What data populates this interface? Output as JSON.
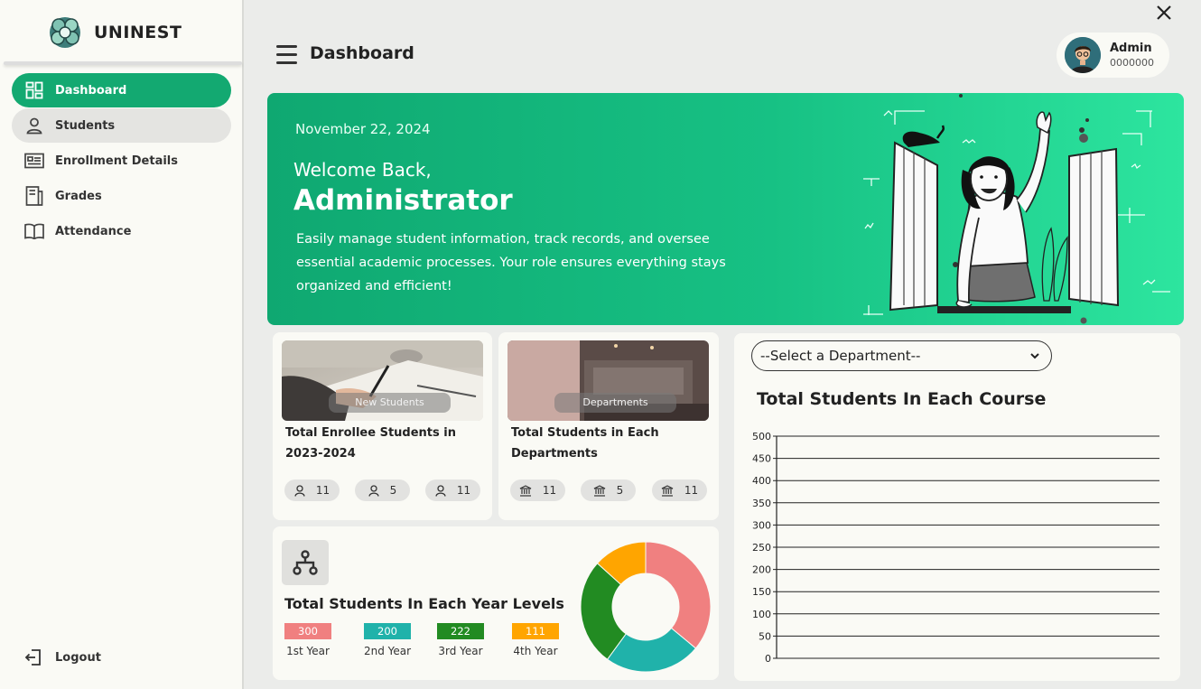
{
  "app": {
    "brand": "UNINEST"
  },
  "sidebar": {
    "items": [
      {
        "label": "Dashboard",
        "icon": "dashboard-grid-icon",
        "active": true
      },
      {
        "label": "Students",
        "icon": "user-icon",
        "hover": true
      },
      {
        "label": "Enrollment Details",
        "icon": "id-card-icon"
      },
      {
        "label": "Grades",
        "icon": "document-icon"
      },
      {
        "label": "Attendance",
        "icon": "book-icon"
      }
    ],
    "logout_label": "Logout"
  },
  "header": {
    "title": "Dashboard",
    "user": {
      "name": "Admin",
      "id": "0000000"
    }
  },
  "banner": {
    "date": "November 22, 2024",
    "welcome": "Welcome Back,",
    "name": "Administrator",
    "description": "Easily manage student information, track records, and oversee essential academic processes. Your role ensures everything stays organized and efficient!"
  },
  "cards": {
    "enrollees": {
      "image_caption": "New Students",
      "title": "Total Enrollee Students in 2023-2024",
      "pills": [
        "11",
        "5",
        "11"
      ]
    },
    "departments": {
      "image_caption": "Departments",
      "title": "Total Students in Each Departments",
      "pills": [
        "11",
        "5",
        "11"
      ]
    }
  },
  "year_levels": {
    "title": "Total Students In Each Year Levels",
    "levels": [
      {
        "label": "1st Year",
        "value": "300",
        "color": "#f08080"
      },
      {
        "label": "2nd Year",
        "value": "200",
        "color": "#20b2aa"
      },
      {
        "label": "3rd Year",
        "value": "222",
        "color": "#228b22"
      },
      {
        "label": "4th Year",
        "value": "111",
        "color": "#ffa500"
      }
    ]
  },
  "course_panel": {
    "select_placeholder": "--Select a Department--",
    "title": "Total Students In Each Course"
  },
  "colors": {
    "accent": "#13a971",
    "banner_end": "#2de59f"
  },
  "chart_data": [
    {
      "type": "pie",
      "title": "",
      "categories": [
        "1st Year",
        "2nd Year",
        "3rd Year",
        "4th Year"
      ],
      "values": [
        300,
        200,
        222,
        111
      ],
      "colors": [
        "#f08080",
        "#20b2aa",
        "#228b22",
        "#ffa500"
      ],
      "donut": true
    },
    {
      "type": "bar",
      "title": "Total Students In Each Course",
      "categories": [],
      "values": [],
      "xlabel": "",
      "ylabel": "",
      "ylim": [
        0,
        500
      ],
      "yticks": [
        "500",
        "450",
        "400",
        "350",
        "300",
        "250",
        "200",
        "150",
        "100",
        "50",
        "0"
      ],
      "grid": true
    }
  ]
}
